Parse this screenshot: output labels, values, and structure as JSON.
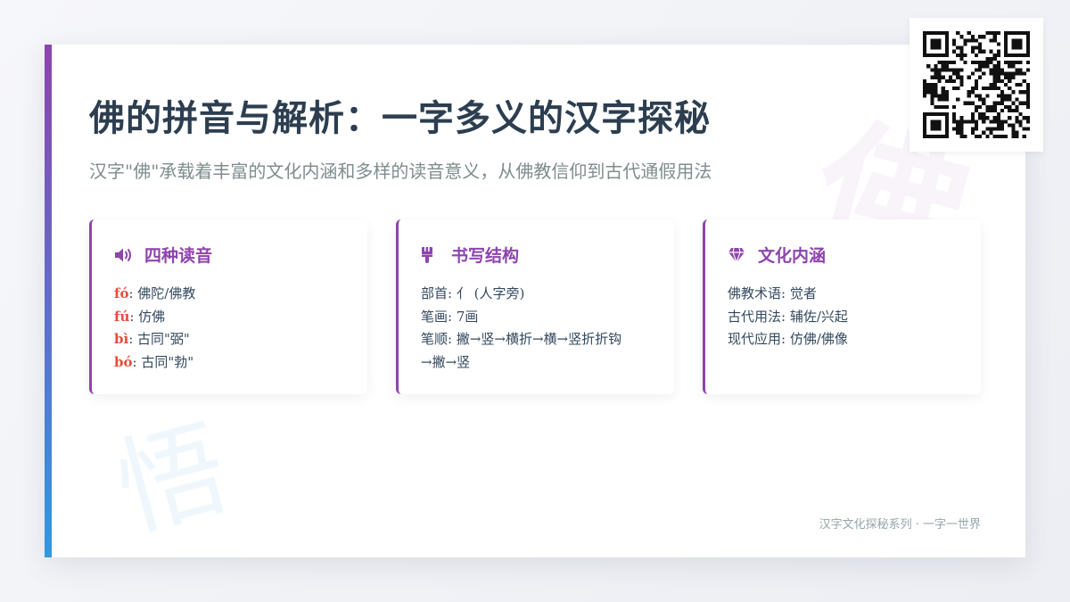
{
  "page": {
    "title": "佛的拼音与解析：一字多义的汉字探秘",
    "subtitle": "汉字\"佛\"承载着丰富的文化内涵和多样的读音意义，从佛教信仰到古代通假用法",
    "watermark_top": "佛",
    "watermark_bottom": "悟",
    "footer": "汉字文化探秘系列 · 一字一世界"
  },
  "colors": {
    "accent": "#8e44ad",
    "accent_secondary": "#3498db",
    "pinyin": "#e74c3c",
    "title": "#2c3e50"
  },
  "panels": [
    {
      "icon": "volume-icon",
      "title": "四种读音",
      "lines": [
        {
          "pinyin": "fó",
          "text": ": 佛陀/佛教"
        },
        {
          "pinyin": "fú",
          "text": ": 仿佛"
        },
        {
          "pinyin": "bì",
          "text": ": 古同\"弼\""
        },
        {
          "pinyin": "bó",
          "text": ": 古同\"勃\""
        }
      ]
    },
    {
      "icon": "paintbrush-icon",
      "title": "书写结构",
      "lines": [
        {
          "text": "部首: 亻 (人字旁)"
        },
        {
          "text": "笔画: 7画"
        },
        {
          "text": "笔顺: 撇→竖→横折→横→竖折折钩"
        },
        {
          "text": "→撇→竖"
        }
      ]
    },
    {
      "icon": "gem-icon",
      "title": "文化内涵",
      "lines": [
        {
          "text": "佛教术语: 觉者"
        },
        {
          "text": "古代用法: 辅佐/兴起"
        },
        {
          "text": "现代应用: 仿佛/佛像"
        }
      ]
    }
  ]
}
